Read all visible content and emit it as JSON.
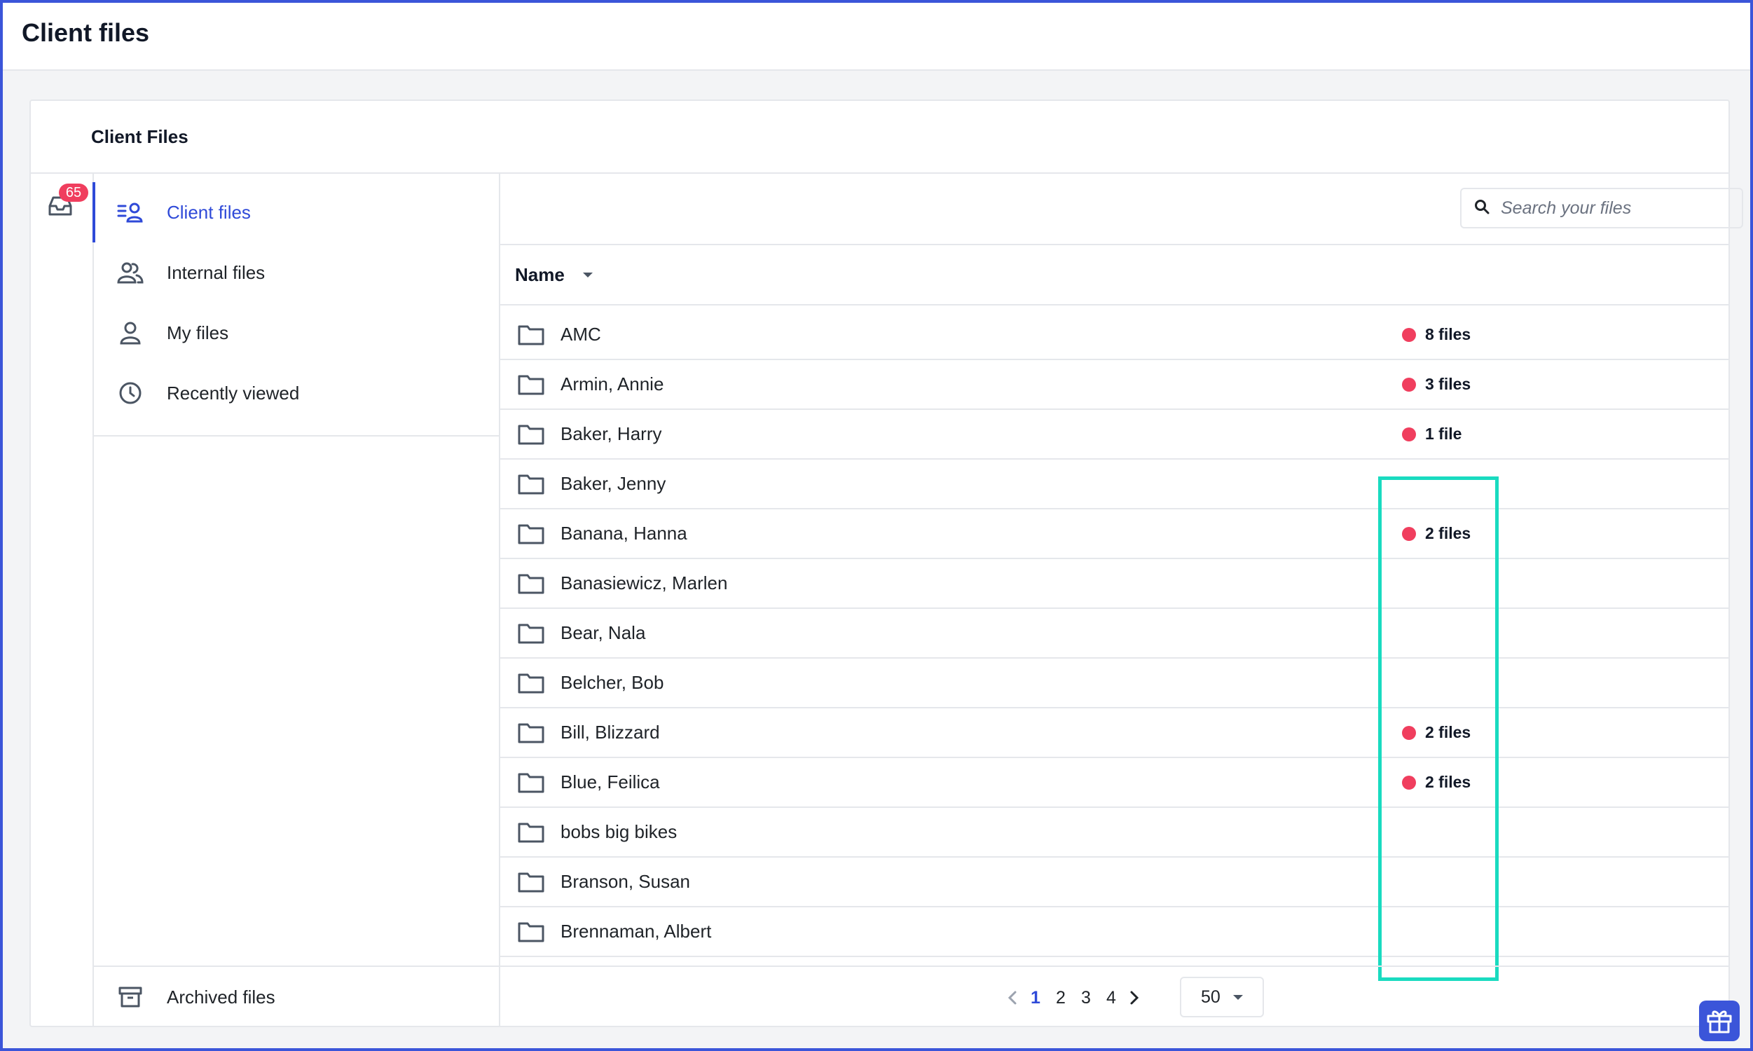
{
  "topbar": {
    "title": "Client files"
  },
  "card": {
    "title": "Client Files"
  },
  "rail": {
    "inbox_count": "65"
  },
  "sidebar": {
    "items": [
      {
        "label": "Client files",
        "icon": "client-files-icon",
        "active": true
      },
      {
        "label": "Internal files",
        "icon": "users-icon",
        "active": false
      },
      {
        "label": "My files",
        "icon": "user-icon",
        "active": false
      },
      {
        "label": "Recently viewed",
        "icon": "clock-icon",
        "active": false
      }
    ],
    "archived_label": "Archived files"
  },
  "search": {
    "placeholder": "Search your files"
  },
  "table": {
    "column_name": "Name",
    "rows": [
      {
        "name": "AMC",
        "files": "8 files"
      },
      {
        "name": "Armin, Annie",
        "files": "3 files"
      },
      {
        "name": "Baker, Harry",
        "files": "1 file"
      },
      {
        "name": "Baker, Jenny",
        "files": ""
      },
      {
        "name": "Banana, Hanna",
        "files": "2 files"
      },
      {
        "name": "Banasiewicz, Marlen",
        "files": ""
      },
      {
        "name": "Bear, Nala",
        "files": ""
      },
      {
        "name": "Belcher, Bob",
        "files": ""
      },
      {
        "name": "Bill, Blizzard",
        "files": "2 files"
      },
      {
        "name": "Blue, Feilica",
        "files": "2 files"
      },
      {
        "name": "bobs big bikes",
        "files": ""
      },
      {
        "name": "Branson, Susan",
        "files": ""
      },
      {
        "name": "Brennaman, Albert",
        "files": ""
      }
    ]
  },
  "pagination": {
    "pages": [
      "1",
      "2",
      "3",
      "4"
    ],
    "current": "1",
    "per_page": "50"
  },
  "colors": {
    "accent": "#2f4ad8",
    "badge": "#f03e5e",
    "highlight": "#19dbc0"
  }
}
